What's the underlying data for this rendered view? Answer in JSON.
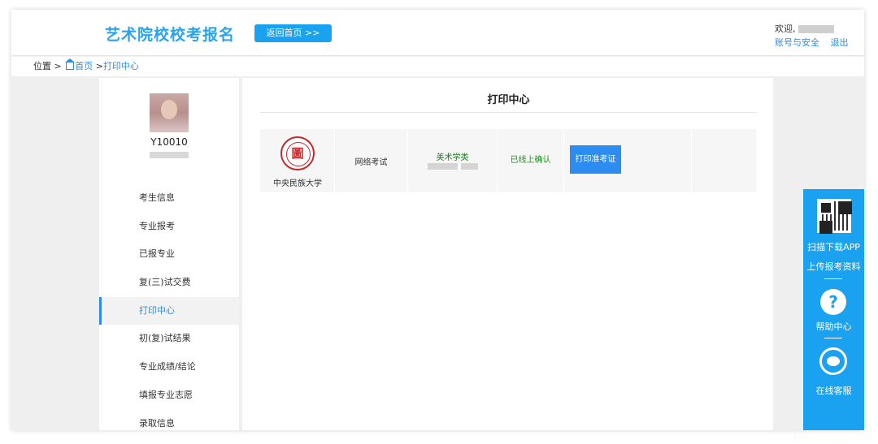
{
  "header": {
    "site_title": "艺术院校校考报名",
    "home_button": "返回首页 >>",
    "welcome": "欢迎,",
    "account_security": "账号与安全",
    "logout": "退出"
  },
  "breadcrumb": {
    "prefix": "位置 >",
    "home": "首页",
    "separator": ">",
    "current": "打印中心"
  },
  "sidebar": {
    "student_id": "Y10010",
    "items": [
      {
        "label": "考生信息"
      },
      {
        "label": "专业报考"
      },
      {
        "label": "已报专业"
      },
      {
        "label": "复(三)试交费"
      },
      {
        "label": "打印中心",
        "active": true
      },
      {
        "label": "初(复)试结果"
      },
      {
        "label": "专业成绩/结论"
      },
      {
        "label": "填报专业志愿"
      },
      {
        "label": "录取信息"
      }
    ]
  },
  "main": {
    "title": "打印中心",
    "record": {
      "university": "中央民族大学",
      "exam_type": "网络考试",
      "major_category": "美术学类",
      "status": "已线上确认",
      "print_button": "打印准考证"
    }
  },
  "floatbar": {
    "scan_download": "扫描下载APP",
    "upload_materials": "上传报考资料",
    "help_icon": "?",
    "help_center": "帮助中心",
    "online_service": "在线客服"
  },
  "colors": {
    "accent": "#1aa1f0",
    "link": "#2e8be8",
    "status_green": "#1f8a1f"
  }
}
